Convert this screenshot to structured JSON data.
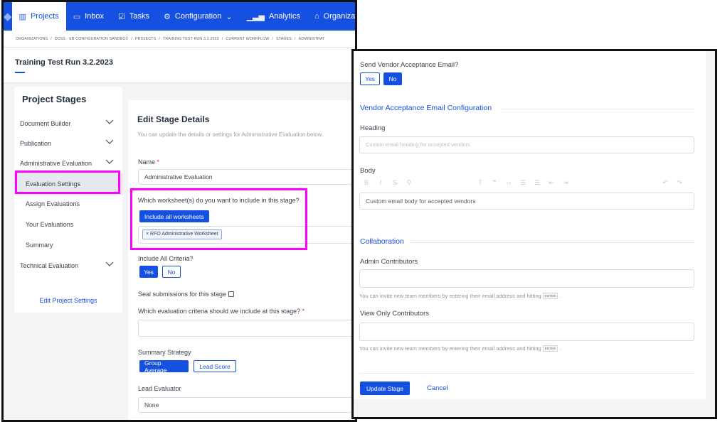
{
  "nav": {
    "items": [
      {
        "label": "Projects",
        "icon": "projects-icon"
      },
      {
        "label": "Inbox",
        "icon": "inbox-icon"
      },
      {
        "label": "Tasks",
        "icon": "tasks-icon"
      },
      {
        "label": "Configuration",
        "icon": "gear-icon"
      },
      {
        "label": "Analytics",
        "icon": "analytics-icon"
      },
      {
        "label": "Organization",
        "icon": "organization-icon"
      }
    ]
  },
  "breadcrumb": [
    "ORGANIZATIONS",
    "/",
    "DCSS - EB CONFIGURATION SANDBOX",
    "/",
    "PROJECTS",
    "/",
    "TRAINING TEST RUN 3.2.2023",
    "/",
    "CURRENT WORKFLOW",
    "/",
    "STAGES",
    "/",
    "ADMINISTRAT"
  ],
  "project": {
    "title": "Training Test Run 3.2.2023"
  },
  "stages": {
    "heading": "Project Stages",
    "items": [
      {
        "label": "Document Builder"
      },
      {
        "label": "Publication"
      },
      {
        "label": "Administrative Evaluation"
      },
      {
        "label": "Evaluation Settings"
      },
      {
        "label": "Assign Evaluations"
      },
      {
        "label": "Your Evaluations"
      },
      {
        "label": "Summary"
      },
      {
        "label": "Technical Evaluation"
      }
    ],
    "edit_link": "Edit Project Settings"
  },
  "edit": {
    "title": "Edit Stage Details",
    "subtitle": "You can update the details or settings for Administrative Evaluation below.",
    "name_label": "Name",
    "required_mark": "*",
    "name_value": "Administrative Evaluation",
    "worksheets_question": "Which worksheet(s) do you want to include in this stage?",
    "include_all_button": "Include all worksheets",
    "worksheet_tag": "RFO Administrative Worksheet",
    "tag_remove": "×",
    "include_criteria_label": "Include All Criteria?",
    "yes": "Yes",
    "no": "No",
    "seal_label": "Seal submissions for this stage",
    "criteria_question": "Which evaluation criteria should we include at this stage?",
    "summary_strategy_label": "Summary Strategy",
    "group_average": "Group Average",
    "lead_score": "Lead Score",
    "lead_evaluator_label": "Lead Evaluator",
    "lead_evaluator_value": "None"
  },
  "right": {
    "vendor_email_question": "Send Vendor Acceptance Email?",
    "yes": "Yes",
    "no": "No",
    "vendor_section": "Vendor Acceptance Email Configuration",
    "heading_label": "Heading",
    "heading_placeholder": "Custom email heading for accepted vendors",
    "body_label": "Body",
    "body_placeholder": "Custom email body for accepted vendors",
    "collab_section": "Collaboration",
    "admin_label": "Admin Contributors",
    "invite_hint": "You can invite new team members by entering their email address and hitting",
    "enter_key": "ENTER",
    "view_only_label": "View Only Contributors",
    "update_button": "Update Stage",
    "cancel_button": "Cancel"
  },
  "colors": {
    "primary": "#1650e0",
    "highlight": "#ff00ff"
  }
}
